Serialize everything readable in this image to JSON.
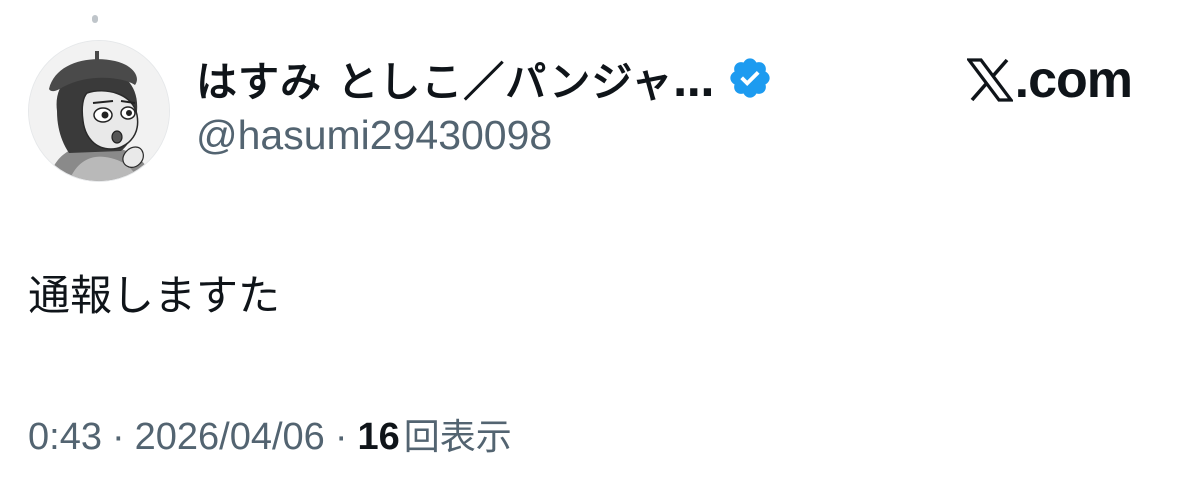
{
  "author": {
    "display_name": "はすみ としこ／パンジャ…",
    "handle": "@hasumi29430098",
    "verified": true,
    "avatar": "cartoon-girl-beret-avatar"
  },
  "brand": {
    "text": ".com",
    "logo": "x-logo-icon"
  },
  "tweet": {
    "text": "通報しますた"
  },
  "meta": {
    "time": "0:43",
    "separator": "·",
    "date": "2026/04/06",
    "views_count": "16",
    "views_label": "回表示"
  },
  "colors": {
    "text_primary": "#0f1419",
    "text_secondary": "#536471",
    "verified_blue": "#1d9bf0"
  }
}
